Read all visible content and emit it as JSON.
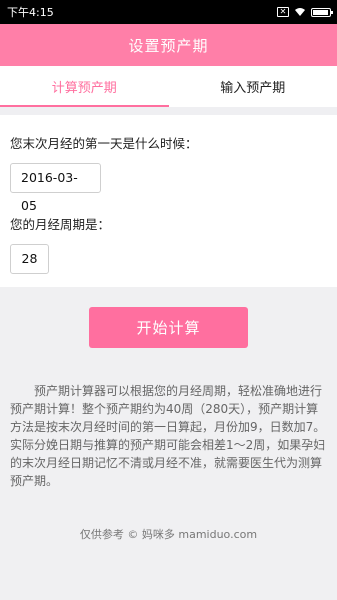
{
  "statusbar": {
    "time": "下午4:15"
  },
  "header": {
    "title": "设置预产期"
  },
  "tabs": [
    {
      "label": "计算预产期",
      "active": true
    },
    {
      "label": "输入预产期",
      "active": false
    }
  ],
  "form": {
    "lmp_question": "您末次月经的第一天是什么时候：",
    "lmp_value": "2016-03-05",
    "cycle_question": "您的月经周期是：",
    "cycle_value": "28"
  },
  "actions": {
    "calculate_label": "开始计算"
  },
  "description": "预产期计算器可以根据您的月经周期，轻松准确地进行预产期计算！整个预产期约为40周（280天），预产期计算方法是按末次月经时间的第一日算起，月份加9，日数加7。实际分娩日期与推算的预产期可能会相差1～2周，如果孕妇的末次月经日期记忆不清或月经不准，就需要医生代为测算预产期。",
  "footer": {
    "text": "仅供参考 © 妈咪多 mamiduo.com"
  },
  "colors": {
    "accent": "#ff6f9f",
    "header_bg": "#ff7fa8",
    "page_bg": "#f0f0f2"
  }
}
